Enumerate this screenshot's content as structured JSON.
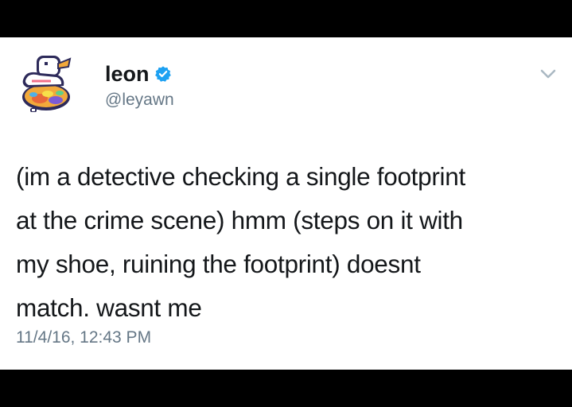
{
  "tweet": {
    "author": {
      "display_name": "leon",
      "handle": "@leyawn",
      "verified": true,
      "avatar_icon": "pixel-bird-on-rainbow-egg-icon"
    },
    "text": "(im a detective checking a single footprint\nat the crime scene) hmm (steps on it with\nmy shoe, ruining the footprint) doesnt\nmatch. wasnt me",
    "timestamp": "11/4/16, 12:43 PM"
  },
  "colors": {
    "background_bars": "#000000",
    "card": "#ffffff",
    "text_primary": "#14171a",
    "text_secondary": "#657786",
    "verified_badge": "#1da1f2"
  },
  "icons": {
    "verified": "verified-badge-icon",
    "menu": "chevron-down-icon"
  }
}
